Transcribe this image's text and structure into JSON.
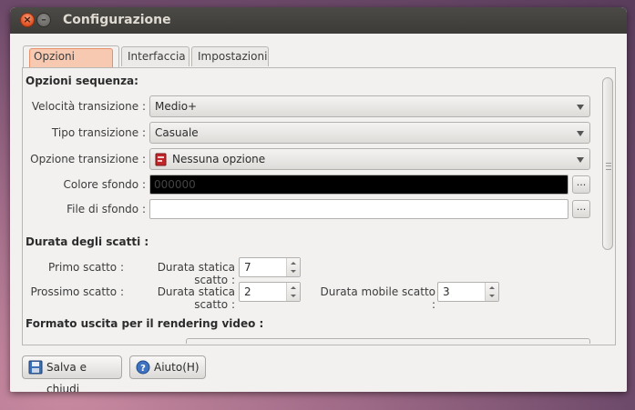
{
  "window": {
    "title": "Configurazione"
  },
  "tabs": [
    {
      "label": "Opzioni progetto",
      "active": true
    },
    {
      "label": "Interfaccia",
      "active": false
    },
    {
      "label": "Impostazioni",
      "active": false
    }
  ],
  "sequence": {
    "title": "Opzioni sequenza:",
    "speed_label": "Velocità transizione :",
    "speed_value": "Medio+",
    "type_label": "Tipo transizione :",
    "type_value": "Casuale",
    "option_label": "Opzione transizione :",
    "option_value": "Nessuna opzione",
    "bg_color_label": "Colore sfondo :",
    "bg_color_value": "000000",
    "bg_file_label": "File di sfondo :",
    "bg_file_value": "",
    "browse_label": "..."
  },
  "durations": {
    "title": "Durata degli scatti :",
    "first_label": "Primo scatto :",
    "static_label": "Durata statica scatto :",
    "first_static_value": "7",
    "next_label": "Prossimo scatto :",
    "next_static_value": "2",
    "mobile_label": "Durata mobile scatto :",
    "mobile_value": "3"
  },
  "output": {
    "title": "Formato uscita per il rendering video :"
  },
  "buttons": {
    "save": "Salva e chiudi",
    "help": "Aiuto(H)"
  },
  "colors": {
    "titlebar": "#3c3b37",
    "active_tab": "#f6c9b0",
    "close_button": "#e4582b"
  }
}
